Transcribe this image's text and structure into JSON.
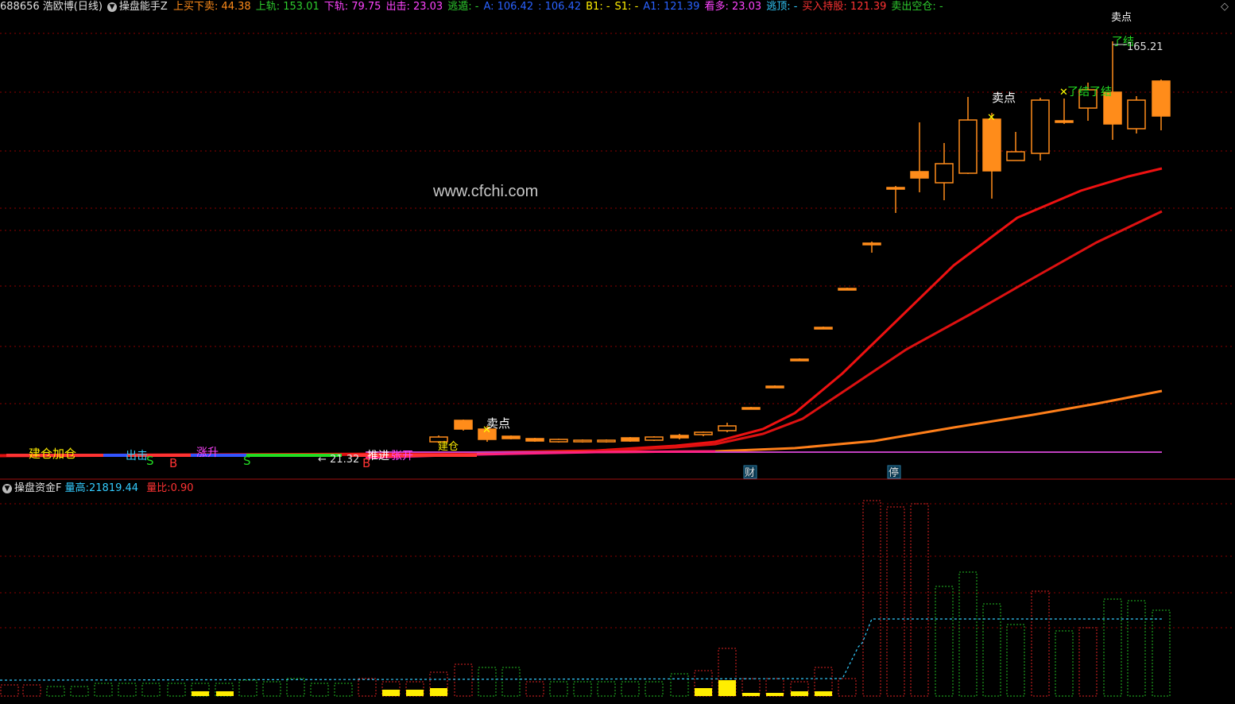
{
  "header": {
    "stock": "688656 浩欧博(日线)",
    "indicator": "操盘能手Z",
    "items": [
      {
        "label": "上买下卖:",
        "value": "44.38",
        "lc": "#ff8c1a",
        "vc": "#ff8c1a"
      },
      {
        "label": "上轨:",
        "value": "153.01",
        "lc": "#2ecc2e",
        "vc": "#2ecc2e"
      },
      {
        "label": "下轨:",
        "value": "79.75",
        "lc": "#ff44ff",
        "vc": "#ff44ff"
      },
      {
        "label": "出击:",
        "value": "23.03",
        "lc": "#ff44ff",
        "vc": "#ff44ff"
      },
      {
        "label": "逃遁:",
        "value": "-",
        "lc": "#2ecc2e",
        "vc": "#2ecc2e"
      },
      {
        "label": "A:",
        "value": "106.42",
        "lc": "#2a62ff",
        "vc": "#2a62ff"
      },
      {
        "label": ":",
        "value": "106.42",
        "lc": "#2a62ff",
        "vc": "#2a62ff"
      },
      {
        "label": "B1:",
        "value": "-",
        "lc": "#ffee00",
        "vc": "#ffee00"
      },
      {
        "label": "S1:",
        "value": "-",
        "lc": "#ffee00",
        "vc": "#ffee00"
      },
      {
        "label": "A1:",
        "value": "121.39",
        "lc": "#2a62ff",
        "vc": "#2a62ff"
      },
      {
        "label": "看多:",
        "value": "23.03",
        "lc": "#ff44ff",
        "vc": "#ff44ff"
      },
      {
        "label": "逃顶:",
        "value": "-",
        "lc": "#33ccff",
        "vc": "#33ccff"
      },
      {
        "label": "买入持股:",
        "value": "121.39",
        "lc": "#ff3333",
        "vc": "#ff3333"
      },
      {
        "label": "卖出空仓:",
        "value": "-",
        "lc": "#2ecc2e",
        "vc": "#2ecc2e"
      }
    ]
  },
  "watermark": "www.cfchi.com",
  "main_chart": {
    "high_label": "165.21",
    "low_label": "← 21.32",
    "signal_labels": [
      "卖点",
      "卖点",
      "卖点",
      "了结",
      "了结了结",
      "建仓加仓",
      "出击",
      "涨升",
      "推进",
      "张开",
      "建仓",
      "S",
      "S",
      "B",
      "B",
      "财",
      "停"
    ],
    "colors": {
      "candle_up": "#ff8c1a",
      "ma_fast": "#ee1111",
      "ma_mid": "#dd1111",
      "ma_slow": "#ff7f1a",
      "baseline": "#c040c0",
      "grid": "#8b0000",
      "sell_mark": "#ffff00"
    }
  },
  "sub_panel": {
    "indicator": "操盘资金F",
    "vol_high_label": "量高:",
    "vol_high_value": "21819.44",
    "vol_ratio_label": "量比:",
    "vol_ratio_value": "0.90"
  }
}
